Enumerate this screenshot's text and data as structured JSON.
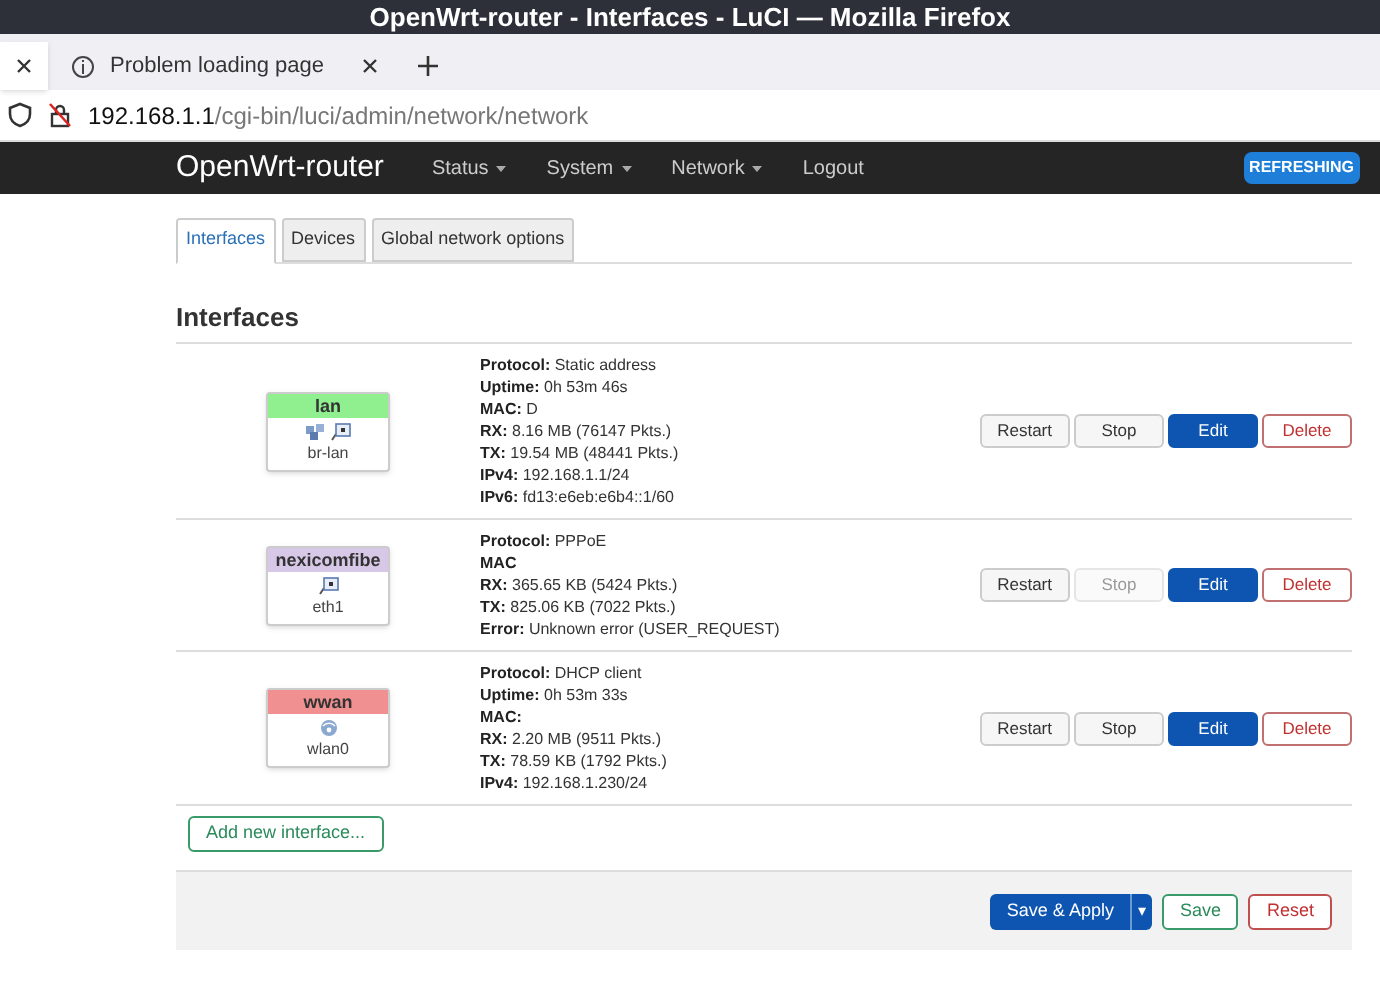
{
  "window": {
    "title": "OpenWrt-router - Interfaces - LuCI — Mozilla Firefox"
  },
  "browser_tabs": [
    {
      "selected": true
    },
    {
      "label": "Problem loading page",
      "selected": false
    }
  ],
  "address_bar": {
    "host": "192.168.1.1",
    "path": "/cgi-bin/luci/admin/network/network"
  },
  "navbar": {
    "brand": "OpenWrt-router",
    "menu": [
      {
        "label": "Status",
        "dropdown": true
      },
      {
        "label": "System",
        "dropdown": true
      },
      {
        "label": "Network",
        "dropdown": true
      },
      {
        "label": "Logout",
        "dropdown": false
      }
    ],
    "badge": "REFRESHING"
  },
  "tabs": [
    {
      "label": "Interfaces",
      "selected": true
    },
    {
      "label": "Devices",
      "selected": false
    },
    {
      "label": "Global network options",
      "selected": false
    }
  ],
  "heading": "Interfaces",
  "interfaces": [
    {
      "name": "lan",
      "color": "#90f090",
      "device": "br-lan",
      "icons": [
        {
          "kind": "bridge"
        },
        {
          "kind": "ethernet"
        }
      ],
      "details": [
        {
          "label": "Protocol:",
          "value": "Static address"
        },
        {
          "label": "Uptime:",
          "value": "0h 53m 46s"
        },
        {
          "label": "MAC:",
          "value": "D"
        },
        {
          "label": "RX:",
          "value": "8.16 MB (76147 Pkts.)"
        },
        {
          "label": "TX:",
          "value": "19.54 MB (48441 Pkts.)"
        },
        {
          "label": "IPv4:",
          "value": "192.168.1.1/24"
        },
        {
          "label": "IPv6:",
          "value": "fd13:e6eb:e6b4::1/60"
        }
      ],
      "actions": [
        {
          "label": "Restart",
          "kind": "default",
          "disabled": false
        },
        {
          "label": "Stop",
          "kind": "default",
          "disabled": false
        },
        {
          "label": "Edit",
          "kind": "primary",
          "disabled": false
        },
        {
          "label": "Delete",
          "kind": "danger",
          "disabled": false
        }
      ]
    },
    {
      "name": "nexicomfibe",
      "color": "#d8c8e8",
      "device": "eth1",
      "icons": [
        {
          "kind": "ethernet"
        }
      ],
      "details": [
        {
          "label": "Protocol:",
          "value": "PPPoE"
        },
        {
          "label": "MAC"
        },
        {
          "label": "RX:",
          "value": "365.65 KB (5424 Pkts.)"
        },
        {
          "label": "TX:",
          "value": "825.06 KB (7022 Pkts.)"
        },
        {
          "label": "Error:",
          "value": "Unknown error (USER_REQUEST)"
        }
      ],
      "actions": [
        {
          "label": "Restart",
          "kind": "default",
          "disabled": false
        },
        {
          "label": "Stop",
          "kind": "default",
          "disabled": true
        },
        {
          "label": "Edit",
          "kind": "primary",
          "disabled": false
        },
        {
          "label": "Delete",
          "kind": "danger",
          "disabled": false
        }
      ]
    },
    {
      "name": "wwan",
      "color": "#f09090",
      "device": "wlan0",
      "icons": [
        {
          "kind": "wifi"
        }
      ],
      "details": [
        {
          "label": "Protocol:",
          "value": "DHCP client"
        },
        {
          "label": "Uptime:",
          "value": "0h 53m 33s"
        },
        {
          "label": "MAC:"
        },
        {
          "label": "RX:",
          "value": "2.20 MB (9511 Pkts.)"
        },
        {
          "label": "TX:",
          "value": "78.59 KB (1792 Pkts.)"
        },
        {
          "label": "IPv4:",
          "value": "192.168.1.230/24"
        }
      ],
      "actions": [
        {
          "label": "Restart",
          "kind": "default",
          "disabled": false
        },
        {
          "label": "Stop",
          "kind": "default",
          "disabled": false
        },
        {
          "label": "Edit",
          "kind": "primary",
          "disabled": false
        },
        {
          "label": "Delete",
          "kind": "danger",
          "disabled": false
        }
      ]
    }
  ],
  "add_button": "Add new interface...",
  "footer": {
    "save_apply": "Save & Apply",
    "caret": "▾",
    "save": "Save",
    "reset": "Reset"
  }
}
